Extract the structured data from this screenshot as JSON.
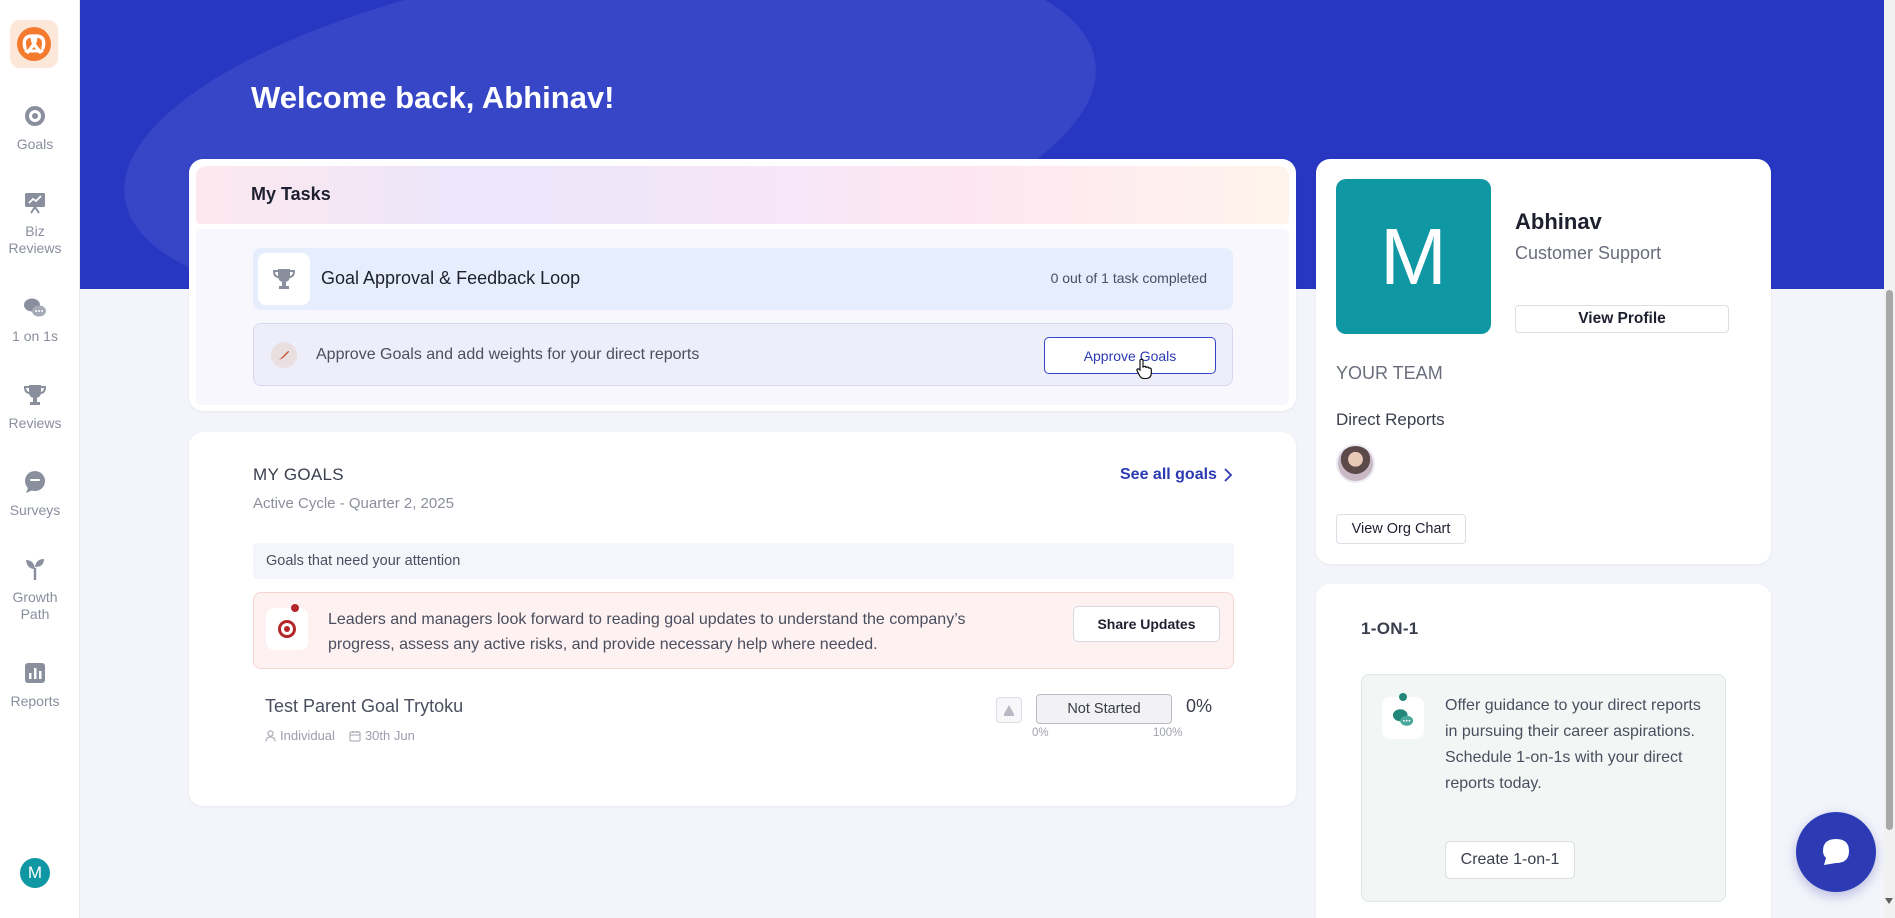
{
  "sidebar": {
    "items": [
      {
        "label": "Goals",
        "icon": "target-icon"
      },
      {
        "label": "Biz Reviews",
        "icon": "presentation-icon"
      },
      {
        "label": "1 on 1s",
        "icon": "chat-bubbles-icon"
      },
      {
        "label": "Reviews",
        "icon": "trophy-icon"
      },
      {
        "label": "Surveys",
        "icon": "speech-bubble-icon"
      },
      {
        "label": "Growth Path",
        "icon": "sprout-icon"
      },
      {
        "label": "Reports",
        "icon": "bar-chart-icon"
      }
    ],
    "user_initial": "M"
  },
  "hero": {
    "welcome": "Welcome back, Abhinav!"
  },
  "tasks": {
    "title": "My Tasks",
    "loop_title": "Goal Approval & Feedback Loop",
    "loop_status": "0 out of 1 task completed",
    "approve_text": "Approve Goals and add weights for your direct reports",
    "approve_button": "Approve Goals"
  },
  "goals": {
    "heading": "MY GOALS",
    "subtitle": "Active Cycle - Quarter 2, 2025",
    "see_all": "See all goals",
    "attention": "Goals that need your attention",
    "share_text": "Leaders and managers look forward to reading goal updates to understand the company’s progress, assess any active risks, and provide necessary help where needed.",
    "share_button": "Share Updates",
    "items": [
      {
        "title": "Test Parent Goal Trytoku",
        "type": "Individual",
        "due": "30th Jun",
        "status": "Not Started",
        "progress": "0%",
        "scale_min": "0%",
        "scale_max": "100%"
      }
    ]
  },
  "profile": {
    "initial": "M",
    "name": "Abhinav",
    "role": "Customer Support",
    "view_profile": "View Profile",
    "team_label": "YOUR TEAM",
    "direct_reports_label": "Direct Reports",
    "org_chart": "View Org Chart"
  },
  "oneonone": {
    "title": "1-ON-1",
    "text_line1": "Offer guidance to your direct reports in pursuing their career aspirations.",
    "text_line2": "Schedule 1-on-1s with your direct reports today.",
    "button": "Create 1-on-1"
  },
  "colors": {
    "brand": "#2737c2",
    "accent": "#2c3bb3",
    "avatar": "#0f97a3",
    "alert": "#b3262a"
  }
}
